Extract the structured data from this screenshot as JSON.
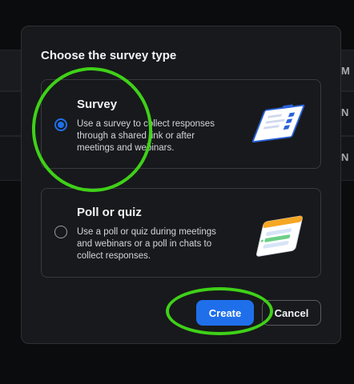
{
  "background": {
    "row_marks": [
      "M",
      "N",
      "N"
    ]
  },
  "dialog": {
    "title": "Choose the survey type",
    "options": [
      {
        "title": "Survey",
        "description": "Use a survey to collect responses through a shared link or after meetings and webinars.",
        "selected": true,
        "illustration": "survey-form-illustration"
      },
      {
        "title": "Poll or quiz",
        "description": "Use a poll or quiz during meetings and webinars or a poll in chats to collect responses.",
        "selected": false,
        "illustration": "poll-card-illustration"
      }
    ],
    "buttons": {
      "create_label": "Create",
      "cancel_label": "Cancel"
    }
  },
  "colors": {
    "accent": "#1f6feb",
    "highlight": "#3fd118",
    "dialog_bg": "#18191c"
  }
}
